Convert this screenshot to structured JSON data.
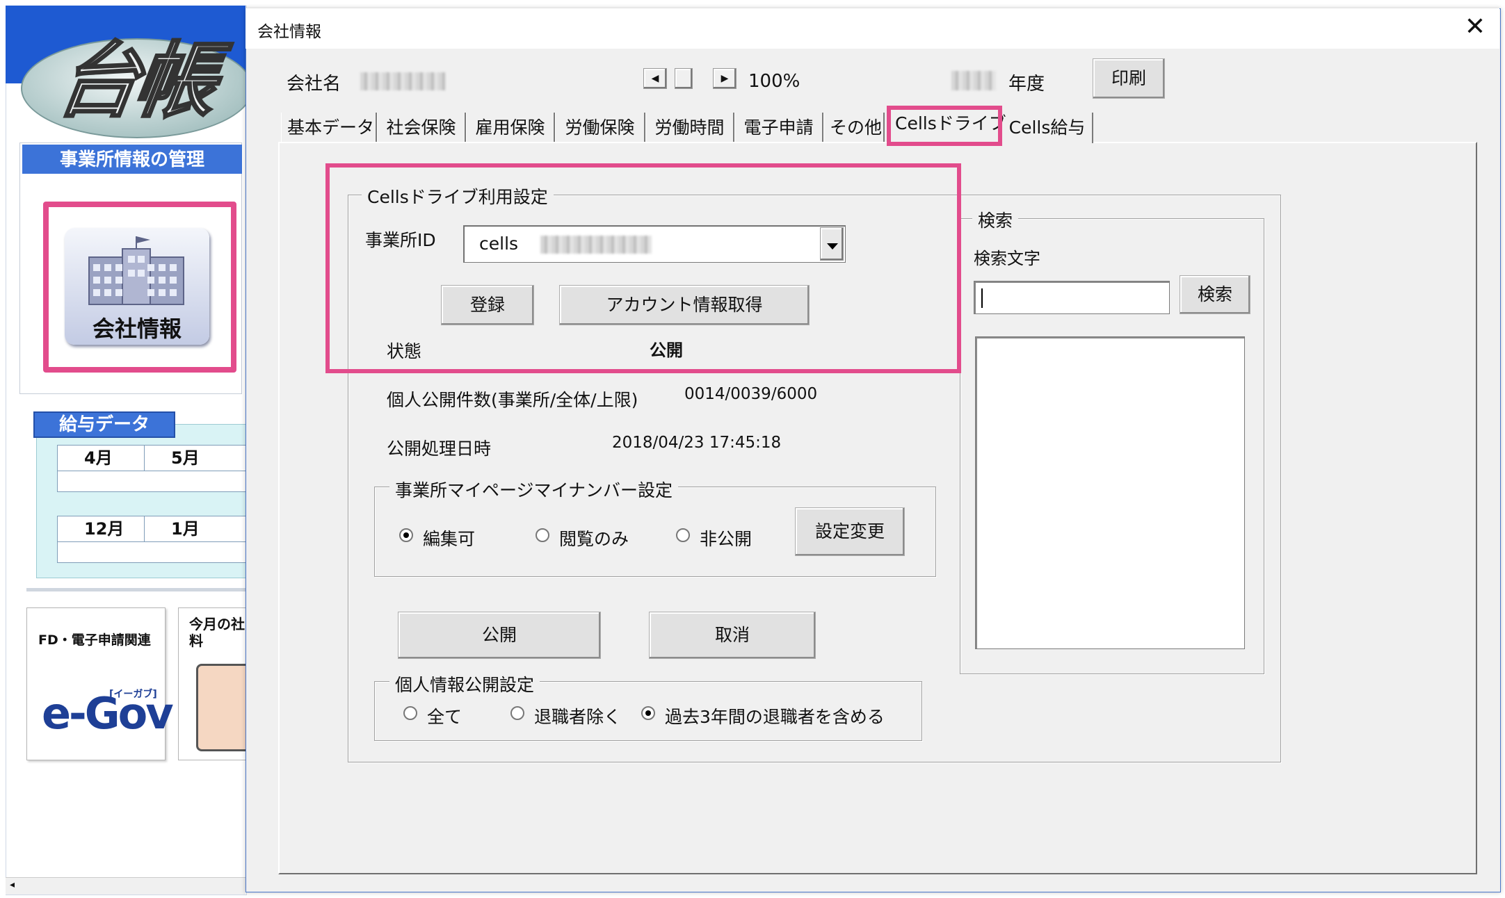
{
  "background_app": {
    "logo_text": "台帳",
    "office_section_header": "事業所情報の管理",
    "company_card_label": "会社情報",
    "salary_section_header": "給与データ",
    "months_row1": [
      "4月",
      "5月"
    ],
    "months_row2": [
      "12月",
      "1月"
    ],
    "fd_card_label": "FD・電子申請関連",
    "egov_logo": "e-Gov",
    "egov_small": "[イーガブ]",
    "month_card_label": "今月の社料"
  },
  "dialog": {
    "title": "会社情報",
    "close_glyph": "✕",
    "company_name_label": "会社名",
    "zoom": "100%",
    "year_label": "年度",
    "print_button": "印刷",
    "tabs": [
      "基本データ",
      "社会保険",
      "雇用保険",
      "労働保険",
      "労働時間",
      "電子申請",
      "その他",
      "Cellsドライブ",
      "Cells給与"
    ],
    "active_tab": "Cellsドライブ"
  },
  "cells_drive": {
    "group_title": "Cellsドライブ利用設定",
    "office_id_label": "事業所ID",
    "office_id_value": "cells",
    "register_button": "登録",
    "account_button": "アカウント情報取得",
    "status_label": "状態",
    "status_value": "公開",
    "count_label": "個人公開件数(事業所/全体/上限)",
    "count_value": "0014/0039/6000",
    "datetime_label": "公開処理日時",
    "datetime_value": "2018/04/23 17:45:18",
    "mynumber_group_title": "事業所マイページマイナンバー設定",
    "mynumber_options": [
      "編集可",
      "閲覧のみ",
      "非公開"
    ],
    "mynumber_selected": "編集可",
    "setting_change_button": "設定変更",
    "publish_button": "公開",
    "cancel_button": "取消",
    "personal_group_title": "個人情報公開設定",
    "personal_options": [
      "全て",
      "退職者除く",
      "過去3年間の退職者を含める"
    ],
    "personal_selected": "過去3年間の退職者を含める"
  },
  "search": {
    "group_title": "検索",
    "text_label": "検索文字",
    "input_value": "",
    "button": "検索"
  },
  "colors": {
    "highlight": "#e24c8c",
    "header_blue": "#3c73d8",
    "dialog_bg": "#f0f0f0"
  }
}
